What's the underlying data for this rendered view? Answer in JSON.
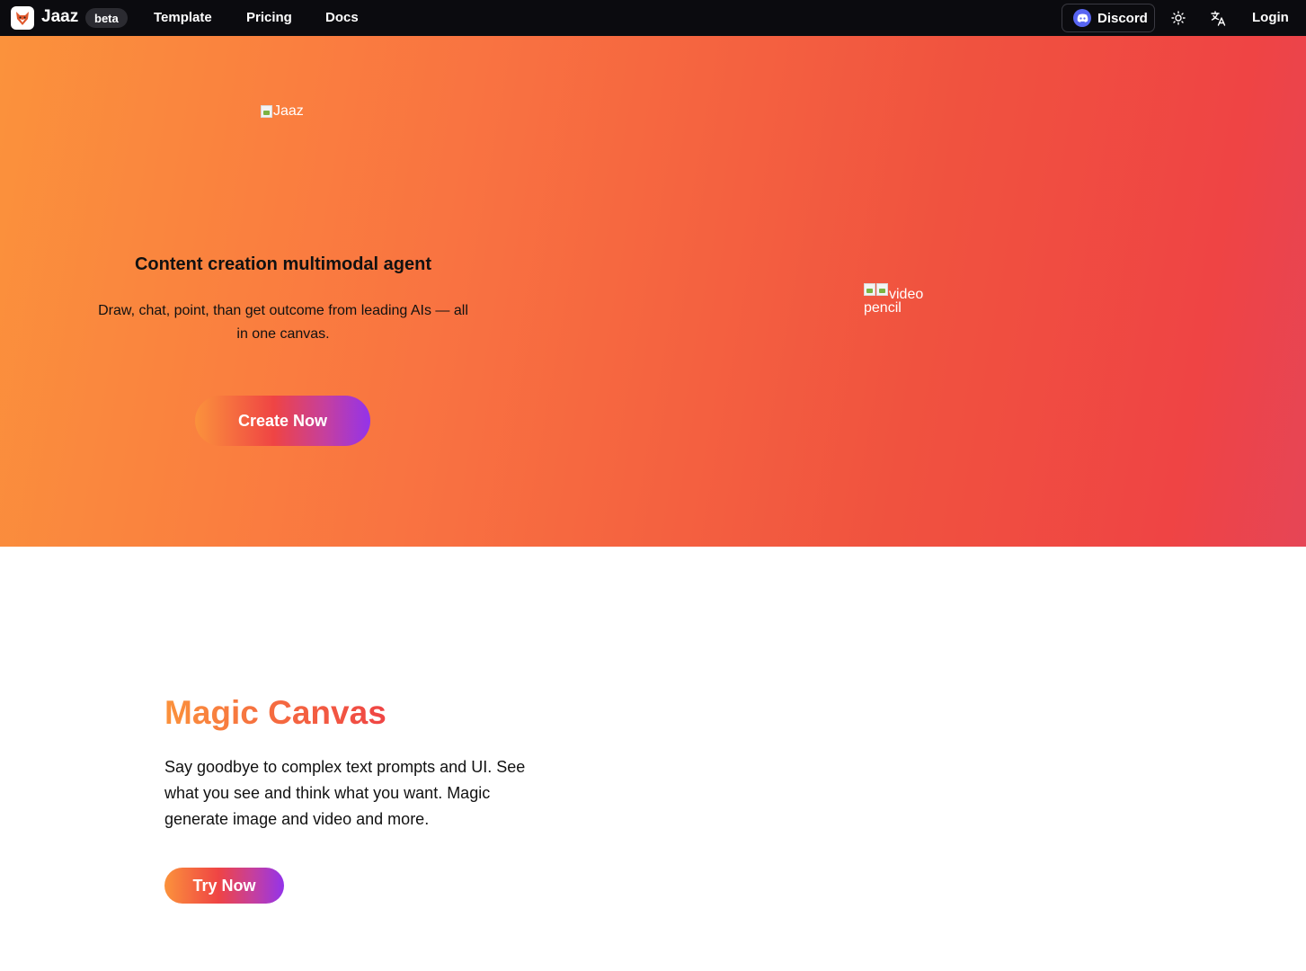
{
  "nav": {
    "brand": "Jaaz",
    "badge": "beta",
    "links": [
      "Template",
      "Pricing",
      "Docs"
    ],
    "discord_label": "Discord",
    "login_label": "Login",
    "icons": {
      "logo": "fox-logo-icon",
      "discord": "discord-icon",
      "theme": "sun-icon",
      "language": "translate-icon"
    }
  },
  "hero": {
    "logo_alt": "Jaaz",
    "title": "Content creation multimodal agent",
    "subtitle": "Draw, chat, point, than get outcome from leading AIs — all in one canvas.",
    "cta_label": "Create Now",
    "media_alt_video": "video",
    "media_alt_pencil": "pencil"
  },
  "magic": {
    "title": "Magic Canvas",
    "description": "Say goodbye to complex text prompts and UI. See what you see and think what you want. Magic generate image and video and more.",
    "cta_label": "Try Now"
  },
  "colors": {
    "nav_bg": "#0b0b0f",
    "hero_gradient_start": "#fb923c",
    "hero_gradient_end": "#ef4444",
    "button_gradient_end": "#9333ea",
    "discord": "#5865f2"
  }
}
